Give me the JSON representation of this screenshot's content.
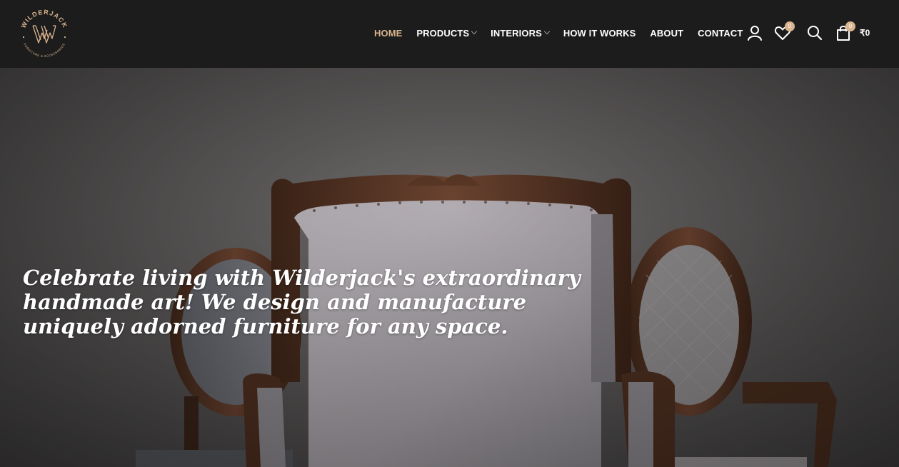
{
  "brand": {
    "logo_text": "WILDERJACK",
    "logo_tagline": "FURNITURE & ACCESSORIES",
    "accent_color": "#d9b48f"
  },
  "nav": {
    "items": [
      {
        "label": "HOME",
        "active": true,
        "has_dropdown": false
      },
      {
        "label": "PRODUCTS",
        "active": false,
        "has_dropdown": true
      },
      {
        "label": "INTERIORS",
        "active": false,
        "has_dropdown": true
      },
      {
        "label": "HOW IT WORKS",
        "active": false,
        "has_dropdown": false
      },
      {
        "label": "ABOUT",
        "active": false,
        "has_dropdown": false
      },
      {
        "label": "CONTACT",
        "active": false,
        "has_dropdown": false
      }
    ]
  },
  "header_icons": {
    "account_icon": "user-icon",
    "wishlist_icon": "heart-icon",
    "wishlist_count": "0",
    "search_icon": "search-icon",
    "cart_icon": "shopping-bag-icon",
    "cart_count": "0",
    "cart_total": "₹0"
  },
  "hero": {
    "headline_lines": [
      "Celebrate living with Wilderjack's extraordinary",
      "handmade art! We design and manufacture",
      "uniquely adorned furniture for any space."
    ]
  }
}
